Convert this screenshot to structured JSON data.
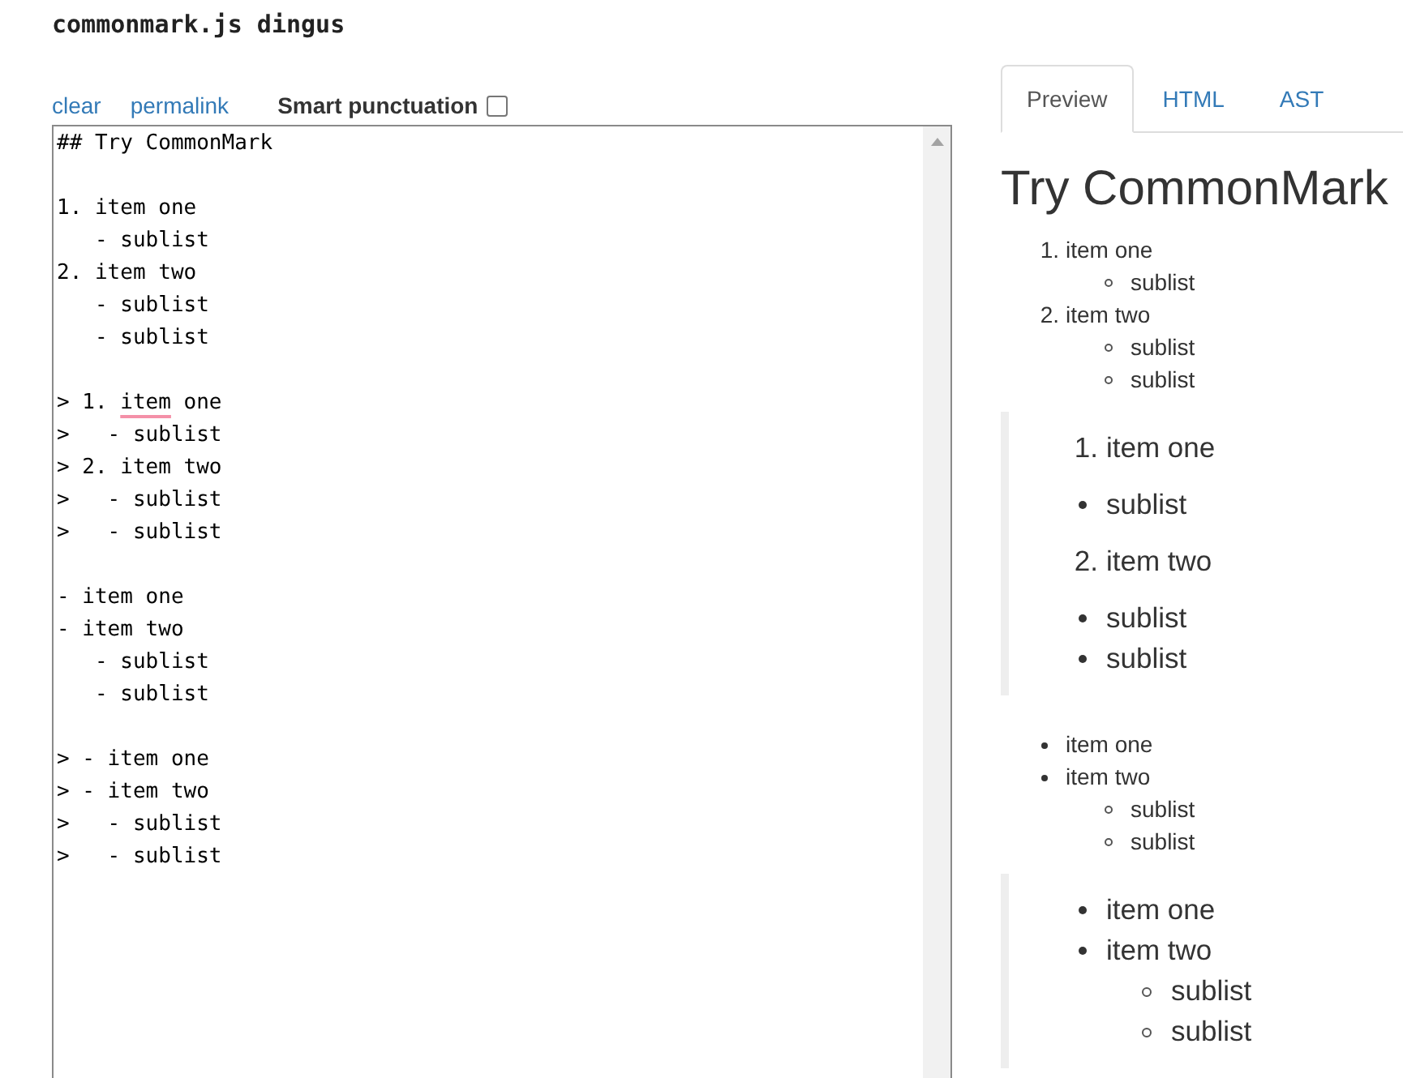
{
  "title": "commonmark.js dingus",
  "toolbar": {
    "links": [
      "clear",
      "permalink"
    ],
    "smart_punctuation": {
      "label": "Smart punctuation",
      "checked": false
    }
  },
  "editor": {
    "blocks": [
      {
        "lines": [
          {
            "segments": [
              {
                "text": "## Try CommonMark",
                "misspelled": false
              }
            ]
          }
        ]
      },
      {
        "lines": [
          {
            "segments": [
              {
                "text": "1. item one",
                "misspelled": false
              }
            ]
          },
          {
            "segments": [
              {
                "text": "   - sublist",
                "misspelled": false
              }
            ]
          },
          {
            "segments": [
              {
                "text": "2. item two",
                "misspelled": false
              }
            ]
          },
          {
            "segments": [
              {
                "text": "   - sublist",
                "misspelled": false
              }
            ]
          },
          {
            "segments": [
              {
                "text": "   - sublist",
                "misspelled": false
              }
            ]
          }
        ]
      },
      {
        "lines": [
          {
            "segments": [
              {
                "text": "> 1. ",
                "misspelled": false
              },
              {
                "text": "item",
                "misspelled": true
              },
              {
                "text": " one",
                "misspelled": false
              }
            ]
          },
          {
            "segments": [
              {
                "text": ">   - sublist",
                "misspelled": false
              }
            ]
          },
          {
            "segments": [
              {
                "text": "> 2. item two",
                "misspelled": false
              }
            ]
          },
          {
            "segments": [
              {
                "text": ">   - sublist",
                "misspelled": false
              }
            ]
          },
          {
            "segments": [
              {
                "text": ">   - sublist",
                "misspelled": false
              }
            ]
          }
        ]
      },
      {
        "lines": [
          {
            "segments": [
              {
                "text": "- item one",
                "misspelled": false
              }
            ]
          },
          {
            "segments": [
              {
                "text": "- item two",
                "misspelled": false
              }
            ]
          },
          {
            "segments": [
              {
                "text": "   - sublist",
                "misspelled": false
              }
            ]
          },
          {
            "segments": [
              {
                "text": "   - sublist",
                "misspelled": false
              }
            ]
          }
        ]
      },
      {
        "lines": [
          {
            "segments": [
              {
                "text": "> - item one",
                "misspelled": false
              }
            ]
          },
          {
            "segments": [
              {
                "text": "> - item two",
                "misspelled": false
              }
            ]
          },
          {
            "segments": [
              {
                "text": ">   - sublist",
                "misspelled": false
              }
            ]
          },
          {
            "segments": [
              {
                "text": ">   - sublist",
                "misspelled": false
              }
            ]
          }
        ]
      }
    ]
  },
  "tabs": [
    {
      "label": "Preview",
      "selected": true
    },
    {
      "label": "HTML",
      "selected": false
    },
    {
      "label": "AST",
      "selected": false
    }
  ],
  "preview": {
    "blocks": [
      {
        "kind": "heading",
        "text": "Try CommonMark"
      },
      {
        "kind": "ordered_list",
        "items": [
          {
            "marker": "1.",
            "text": "item one",
            "children": [
              {
                "text": "sublist"
              }
            ]
          },
          {
            "marker": "2.",
            "text": "item two",
            "children": [
              {
                "text": "sublist"
              },
              {
                "text": "sublist"
              }
            ]
          }
        ]
      },
      {
        "kind": "blockquote",
        "blocks": [
          {
            "kind": "ordered_list",
            "items": [
              {
                "marker": "1.",
                "text": "item one"
              }
            ]
          },
          {
            "kind": "bullet_list",
            "items": [
              {
                "text": "sublist"
              }
            ]
          },
          {
            "kind": "ordered_list",
            "items": [
              {
                "marker": "2.",
                "text": "item two"
              }
            ]
          },
          {
            "kind": "bullet_list",
            "items": [
              {
                "text": "sublist"
              },
              {
                "text": "sublist"
              }
            ]
          }
        ]
      },
      {
        "kind": "bullet_list",
        "items": [
          {
            "text": "item one"
          },
          {
            "text": "item two",
            "children": [
              {
                "text": "sublist"
              },
              {
                "text": "sublist"
              }
            ]
          }
        ]
      },
      {
        "kind": "blockquote",
        "blocks": [
          {
            "kind": "bullet_list",
            "items": [
              {
                "text": "item one"
              },
              {
                "text": "item two",
                "children": [
                  {
                    "text": "sublist"
                  },
                  {
                    "text": "sublist"
                  }
                ]
              }
            ]
          }
        ]
      }
    ]
  }
}
